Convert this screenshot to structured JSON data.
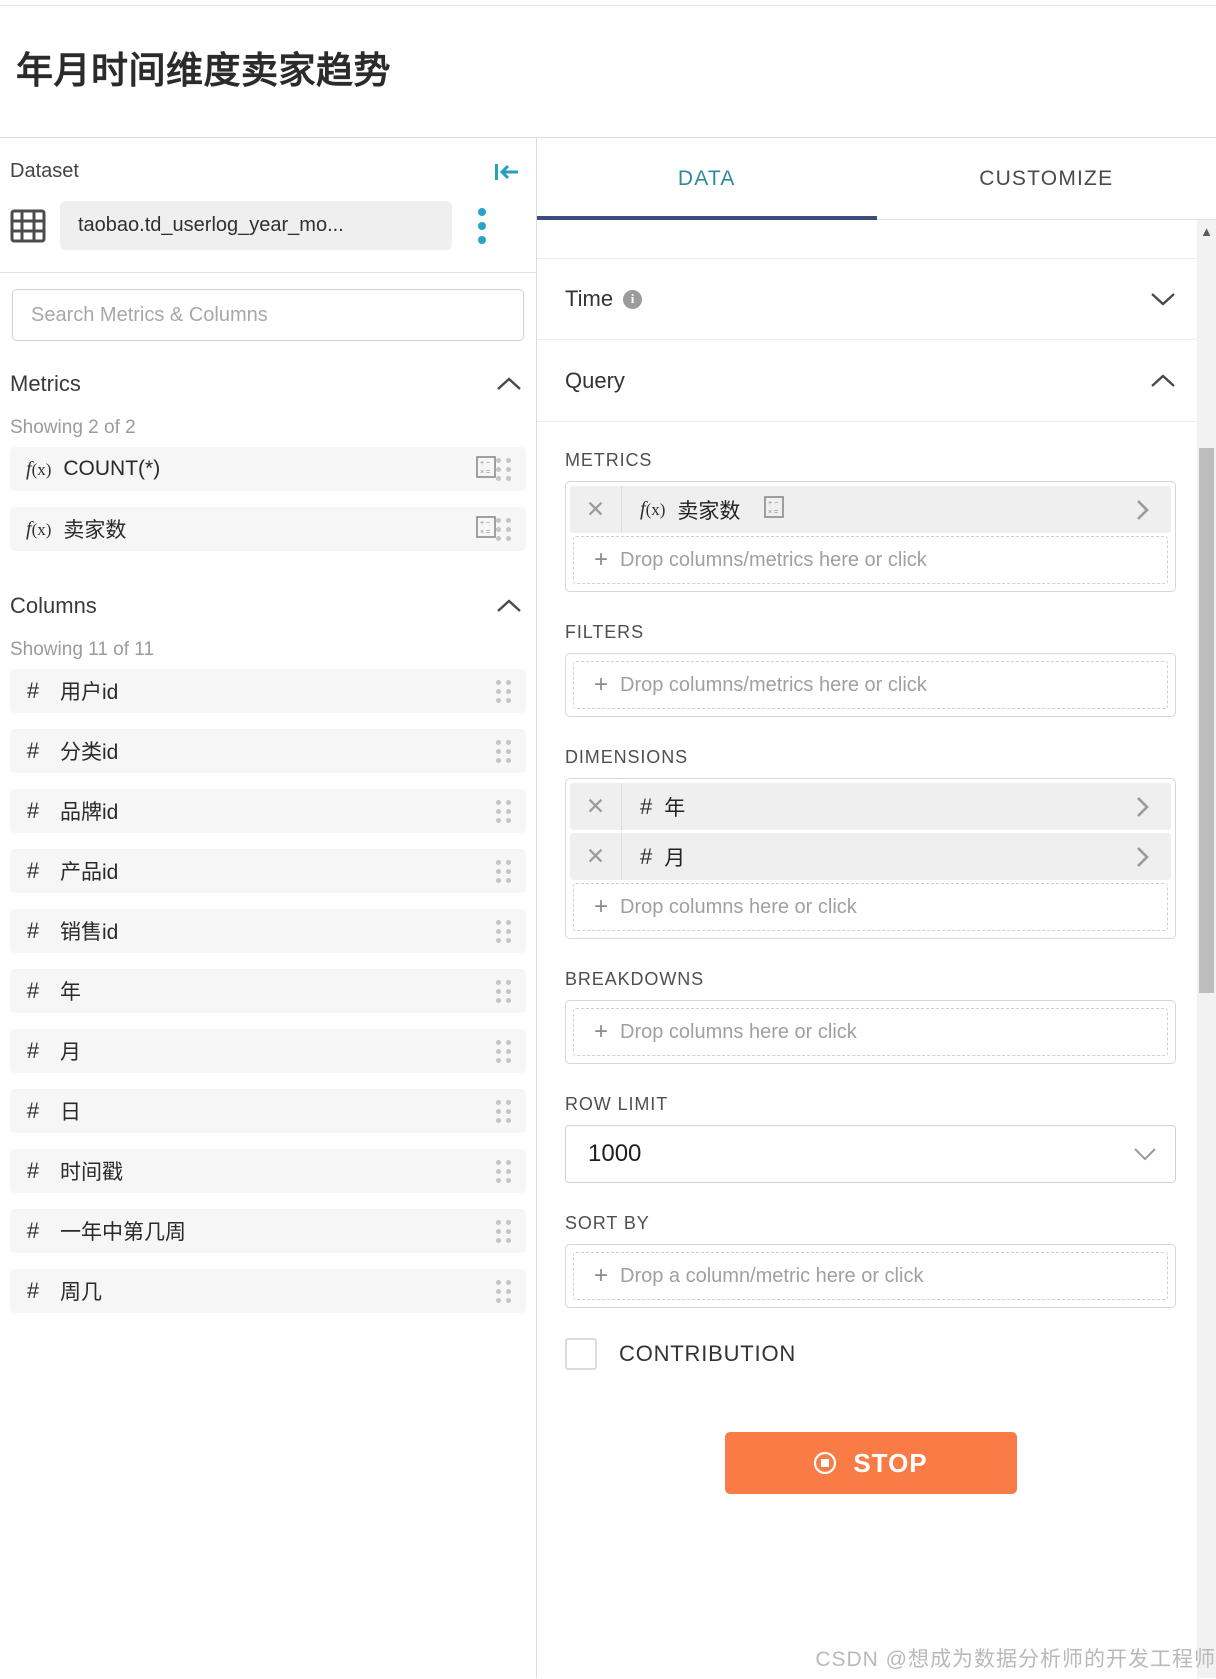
{
  "header": {
    "title": "年月时间维度卖家趋势"
  },
  "left_panel": {
    "dataset_label": "Dataset",
    "collapse_icon": "collapse-left-icon",
    "dataset_name": "taobao.td_userlog_year_mo...",
    "search_placeholder": "Search Metrics & Columns",
    "search_value": "",
    "metrics": {
      "title": "Metrics",
      "showing": "Showing 2 of 2",
      "items": [
        {
          "label": "COUNT(*)",
          "type": "metric",
          "icon": "fx-icon",
          "badge": "calculator-icon"
        },
        {
          "label": "卖家数",
          "type": "metric",
          "icon": "fx-icon",
          "badge": "calculator-icon"
        }
      ]
    },
    "columns": {
      "title": "Columns",
      "showing": "Showing 11 of 11",
      "items": [
        {
          "label": "用户id",
          "type": "numeric"
        },
        {
          "label": "分类id",
          "type": "numeric"
        },
        {
          "label": "品牌id",
          "type": "numeric"
        },
        {
          "label": "产品id",
          "type": "numeric"
        },
        {
          "label": "销售id",
          "type": "numeric"
        },
        {
          "label": "年",
          "type": "numeric"
        },
        {
          "label": "月",
          "type": "numeric"
        },
        {
          "label": "日",
          "type": "numeric"
        },
        {
          "label": "时间戳",
          "type": "numeric"
        },
        {
          "label": "一年中第几周",
          "type": "numeric"
        },
        {
          "label": "周几",
          "type": "numeric"
        }
      ]
    }
  },
  "right_panel": {
    "tabs": [
      {
        "label": "DATA",
        "active": true
      },
      {
        "label": "CUSTOMIZE",
        "active": false
      }
    ],
    "accordions": [
      {
        "label": "Time",
        "expanded": false,
        "has_info": true
      },
      {
        "label": "Query",
        "expanded": true,
        "has_info": false
      }
    ],
    "query": {
      "metrics": {
        "label": "METRICS",
        "chips": [
          {
            "text": "卖家数",
            "kind": "metric",
            "badge": "calculator-icon"
          }
        ],
        "dropzone": "Drop columns/metrics here or click"
      },
      "filters": {
        "label": "FILTERS",
        "chips": [],
        "dropzone": "Drop columns/metrics here or click"
      },
      "dimensions": {
        "label": "DIMENSIONS",
        "chips": [
          {
            "text": "年",
            "kind": "column"
          },
          {
            "text": "月",
            "kind": "column"
          }
        ],
        "dropzone": "Drop columns here or click"
      },
      "breakdowns": {
        "label": "BREAKDOWNS",
        "chips": [],
        "dropzone": "Drop columns here or click"
      },
      "row_limit": {
        "label": "ROW LIMIT",
        "value": "1000"
      },
      "sort_by": {
        "label": "SORT BY",
        "dropzone": "Drop a column/metric here or click"
      },
      "contribution": {
        "label": "CONTRIBUTION",
        "checked": false
      }
    },
    "stop_button": {
      "label": "STOP",
      "icon": "stop-circle-icon",
      "color": "#f97c46"
    }
  },
  "watermark": "CSDN @想成为数据分析师的开发工程师",
  "colors": {
    "accent_teal": "#27a5c8",
    "tab_active": "#2d8a9e",
    "tab_underline": "#3c4b7a",
    "stop_orange": "#f97c46"
  }
}
